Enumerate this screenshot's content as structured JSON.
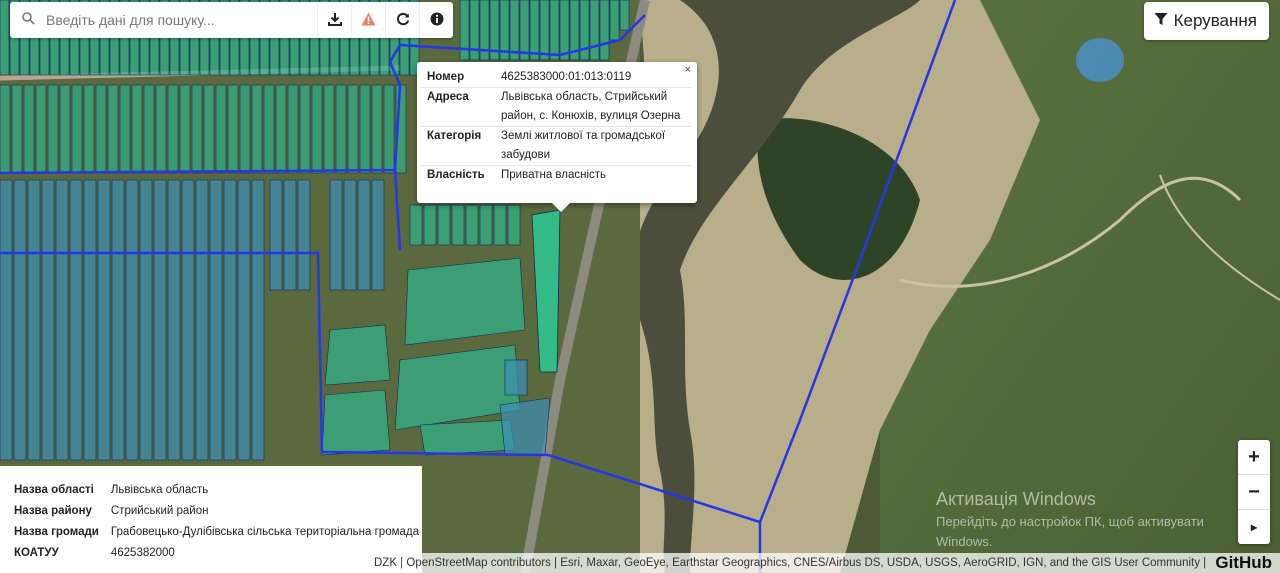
{
  "search": {
    "placeholder": "Введіть дані для пошуку..."
  },
  "toolbar": {
    "icons": [
      "search-icon",
      "download-icon",
      "warning-icon",
      "refresh-icon",
      "info-icon"
    ]
  },
  "controls_button": {
    "label": "Керування"
  },
  "popup": {
    "rows": [
      {
        "key": "Номер",
        "value": "4625383000:01:013:0119"
      },
      {
        "key": "Адреса",
        "value": "Львівська область, Стрийський район, с. Конюхів, вулиця Озерна"
      },
      {
        "key": "Категорія",
        "value": "Землі житлової та громадської забудови"
      },
      {
        "key": "Власність",
        "value": "Приватна власність"
      }
    ],
    "close": "×"
  },
  "info_panel": {
    "rows": [
      {
        "key": "Назва області",
        "value": "Львівська область"
      },
      {
        "key": "Назва району",
        "value": "Стрийський район"
      },
      {
        "key": "Назва громади",
        "value": "Грабовецько-Дулібівська сільська територіальна громада"
      },
      {
        "key": "КОАТУУ",
        "value": "4625382000"
      }
    ]
  },
  "zoom": {
    "in": "+",
    "out": "−",
    "locate": "▸"
  },
  "attribution": {
    "dzk": "DZK",
    "sep": " | ",
    "osm": "OpenStreetMap contributors",
    "rest": " | Esri, Maxar, GeoEye, Earthstar Geographics, CNES/Airbus DS, USDA, USGS, AeroGRID, IGN, and the GIS User Community | ",
    "github": "GitHub"
  },
  "watermark": {
    "title": "Активація Windows",
    "line1": "Перейдіть до настройок ПК, щоб активувати",
    "line2": "Windows."
  },
  "colors": {
    "parcel_green": "#2fb38a",
    "parcel_blue": "#3d8fb5",
    "boundary": "#2336e8",
    "selected": "#31c48f"
  }
}
